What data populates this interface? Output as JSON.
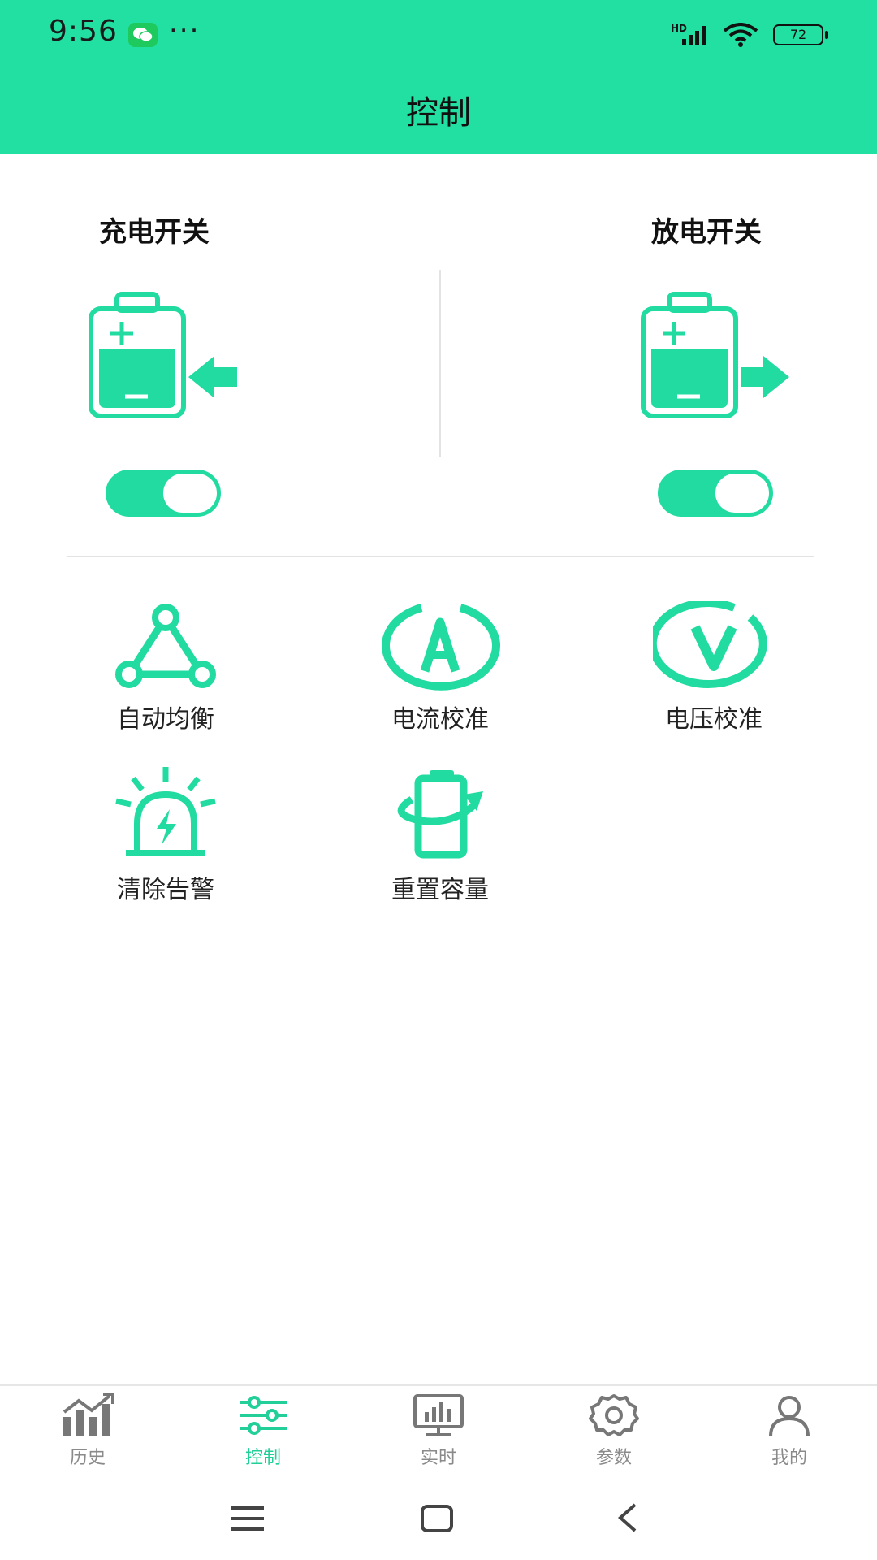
{
  "status_bar": {
    "time": "9:56",
    "dots": "···",
    "network": "HD",
    "battery": "72"
  },
  "header": {
    "title": "控制"
  },
  "switches": {
    "charge": {
      "label": "充电开关",
      "state": true
    },
    "discharge": {
      "label": "放电开关",
      "state": true
    }
  },
  "functions": [
    {
      "label": "自动均衡",
      "icon": "balance-triangle-icon"
    },
    {
      "label": "电流校准",
      "icon": "current-a-icon"
    },
    {
      "label": "电压校准",
      "icon": "voltage-v-icon"
    },
    {
      "label": "清除告警",
      "icon": "alarm-light-icon"
    },
    {
      "label": "重置容量",
      "icon": "reset-capacity-icon"
    }
  ],
  "nav": {
    "items": [
      {
        "label": "历史",
        "icon": "chart-icon"
      },
      {
        "label": "控制",
        "icon": "sliders-icon",
        "active": true
      },
      {
        "label": "实时",
        "icon": "monitor-icon"
      },
      {
        "label": "参数",
        "icon": "gear-icon"
      },
      {
        "label": "我的",
        "icon": "user-icon"
      }
    ]
  },
  "colors": {
    "accent": "#22e0a1",
    "icon_green": "#22dba0",
    "inactive": "#8a8a8a"
  }
}
